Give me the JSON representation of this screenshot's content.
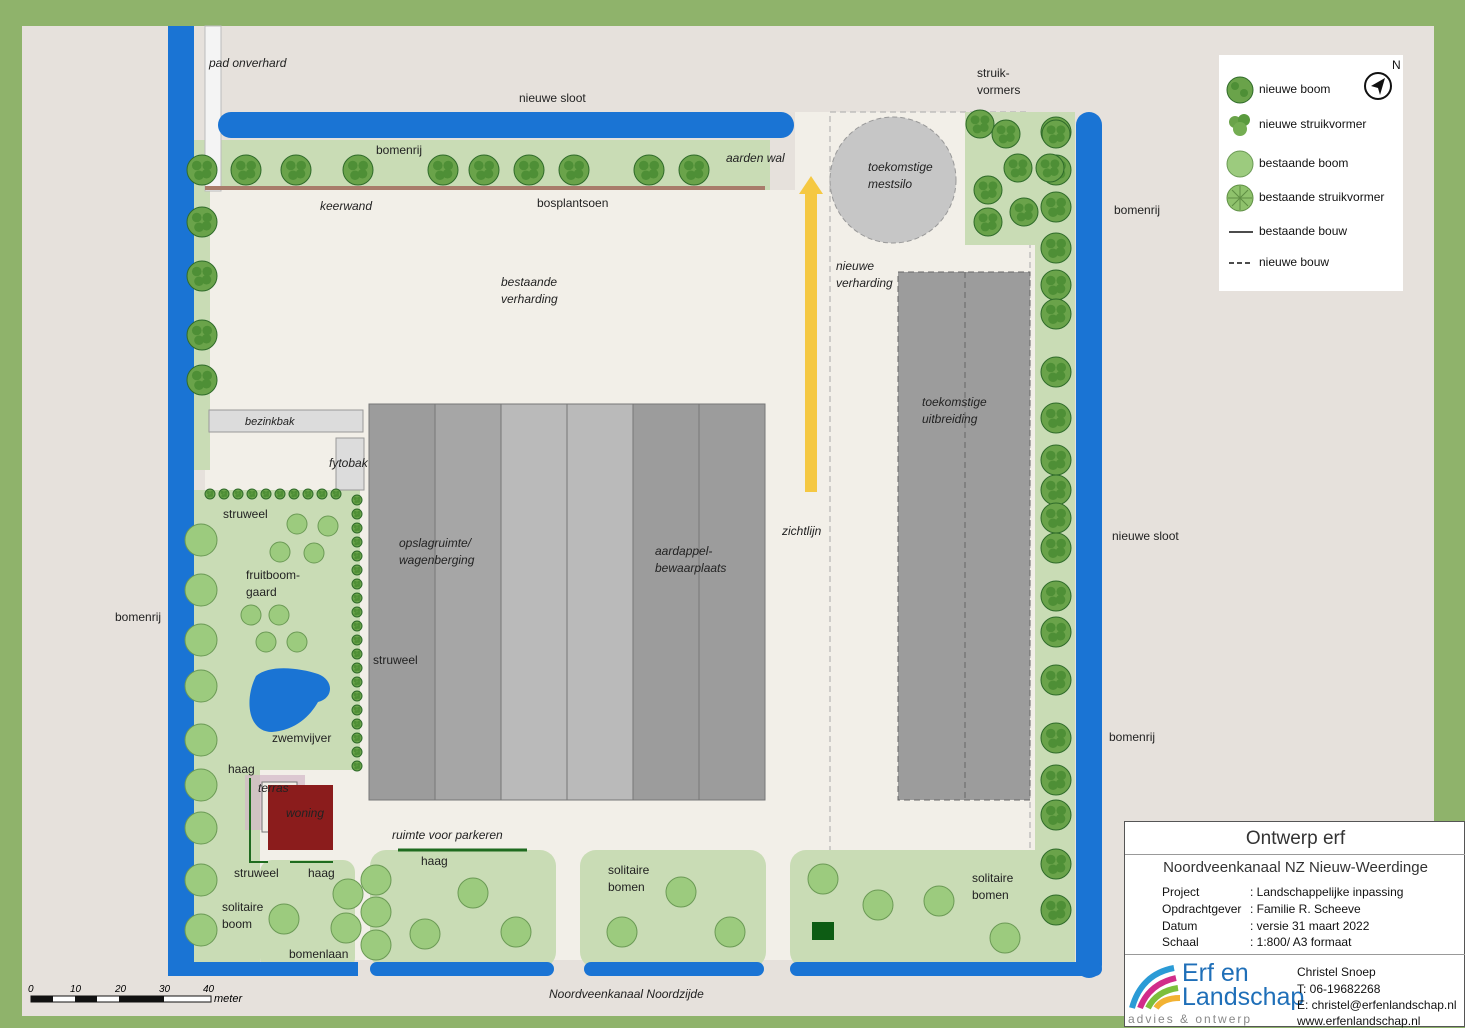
{
  "labels": {
    "pad_onverhard": "pad onverhard",
    "nieuwe_sloot_top": "nieuwe sloot",
    "bomenrij_top": "bomenrij",
    "aarden_wal": "aarden wal",
    "keerwand": "keerwand",
    "bosplantsoen": "bosplantsoen",
    "struikvormers": [
      "struik-",
      "vormers"
    ],
    "toekomstige_mestsilo": [
      "toekomstige",
      "mestsilo"
    ],
    "bomenrij_right_top": "bomenrij",
    "nieuwe_verharding": [
      "nieuwe",
      "verharding"
    ],
    "bestaande_verharding": [
      "bestaande",
      "verharding"
    ],
    "bezinkbak": "bezinkbak",
    "fytobak": "fytobak",
    "toekomstige_uitbreiding": [
      "toekomstige",
      "uitbreiding"
    ],
    "struweel_top": "struweel",
    "opslagruimte": [
      "opslagruimte/",
      "wagenberging"
    ],
    "aardappel": [
      "aardappel-",
      "bewaarplaats"
    ],
    "zichtlijn": "zichtlijn",
    "nieuwe_sloot_right": "nieuwe sloot",
    "fruitboomgaard": [
      "fruitboom-",
      "gaard"
    ],
    "bomenrij_left": "bomenrij",
    "struweel_mid": "struweel",
    "zwemvijver": "zwemvijver",
    "bomenrij_right_bottom": "bomenrij",
    "haag_left": "haag",
    "terras": "terras",
    "woning": "woning",
    "ruimte_parkeren": "ruimte voor parkeren",
    "haag_parking": "haag",
    "struweel_bottom": "struweel",
    "haag_bottom": "haag",
    "solitaire_bomen_mid": [
      "solitaire",
      "bomen"
    ],
    "solitaire_bomen_right": [
      "solitaire",
      "bomen"
    ],
    "solitaire_boom": [
      "solitaire",
      "boom"
    ],
    "bomenlaan": "bomenlaan",
    "noordveenkanaal": "Noordveenkanaal Noordzijde"
  },
  "legend": [
    {
      "symbol": "nieuwe-boom-icon",
      "label": "nieuwe boom"
    },
    {
      "symbol": "nieuwe-struikvormer-icon",
      "label": "nieuwe struikvormer"
    },
    {
      "symbol": "bestaande-boom-icon",
      "label": "bestaande boom"
    },
    {
      "symbol": "bestaande-struikvormer-icon",
      "label": "bestaande struikvormer"
    },
    {
      "symbol": "solid-line-icon",
      "label": "bestaande bouw"
    },
    {
      "symbol": "dashed-line-icon",
      "label": "nieuwe bouw"
    }
  ],
  "north_label": "N",
  "scale": {
    "ticks": [
      "0",
      "10",
      "20",
      "30",
      "40"
    ],
    "unit": "meter"
  },
  "titleblock": {
    "title": "Ontwerp erf",
    "subtitle": "Noordveenkanaal NZ Nieuw-Weerdinge",
    "rows": [
      {
        "key": "Project",
        "value": ": Landschappelijke inpassing"
      },
      {
        "key": "Opdrachtgever",
        "value": ": Familie R. Scheeve"
      },
      {
        "key": "Datum",
        "value": ": versie 31 maart 2022"
      },
      {
        "key": "Schaal",
        "value": ": 1:800/ A3 formaat"
      }
    ],
    "logo_line1": "Erf en",
    "logo_line2": "Landschap",
    "logo_tagline": "advies & ontwerp",
    "contact": [
      "Christel Snoep",
      "T: 06-19682268",
      "E: christel@erfenlandschap.nl",
      "www.erfenlandschap.nl"
    ]
  },
  "colors": {
    "border": "#8fb36b",
    "ground": "#e6e1dc",
    "paving": "#f2efe8",
    "green": "#c9dcb5",
    "water": "#1a74d4",
    "building_dark": "#9c9c9c",
    "building_light": "#bababa",
    "house": "#8b1c1c",
    "arrow": "#f5c842"
  }
}
